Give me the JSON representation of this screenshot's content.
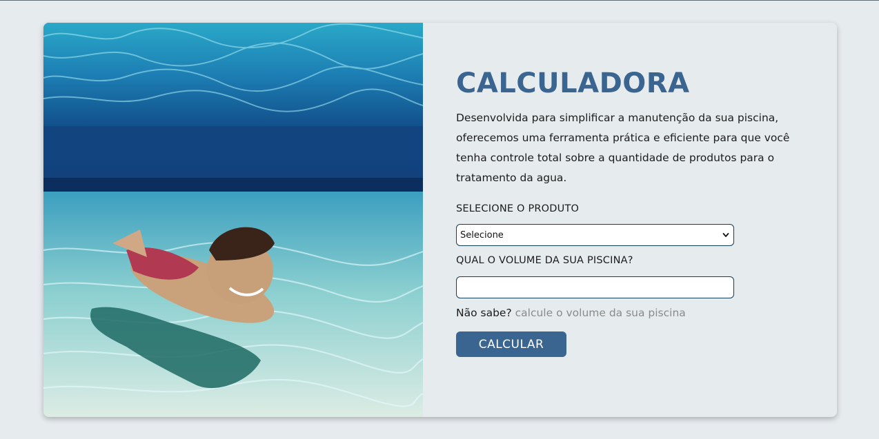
{
  "photo": {
    "alt": "swimmer-underwater"
  },
  "calculator": {
    "title": "CALCULADORA",
    "description": "Desenvolvida para simplificar a manutenção da sua piscina, oferecemos uma ferramenta prática e eficiente para que você tenha controle total sobre a quantidade de produtos para o tratamento da agua.",
    "product_label": "SELECIONE O PRODUTO",
    "product_select": {
      "selected": "Selecione"
    },
    "volume_label": "QUAL O VOLUME DA SUA PISCINA?",
    "volume_input": {
      "value": ""
    },
    "help_prefix": "Não sabe?",
    "help_link": "calcule o volume da sua piscina",
    "button_label": "CALCULAR"
  },
  "colors": {
    "background": "#e6ebee",
    "accent": "#3a6590",
    "input_border": "#123c5a",
    "link": "#8a8a8a"
  }
}
